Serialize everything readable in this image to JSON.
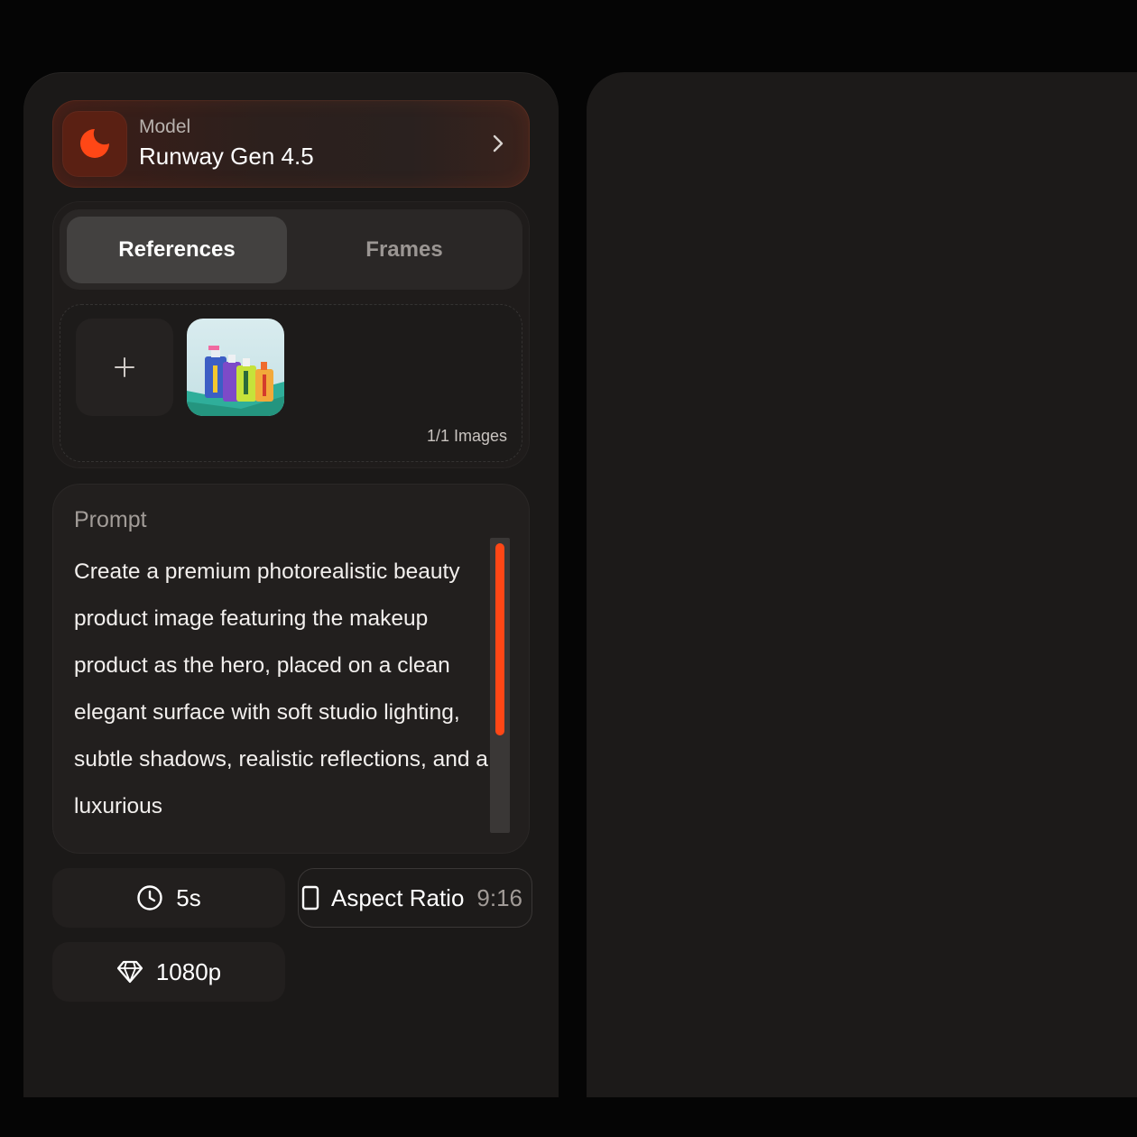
{
  "model": {
    "label": "Model",
    "name": "Runway Gen 4.5",
    "accent": "#ff4716"
  },
  "tabs": [
    {
      "label": "References",
      "active": true
    },
    {
      "label": "Frames",
      "active": false
    }
  ],
  "references": {
    "count_label": "1/1 Images",
    "add_icon": "plus-icon",
    "thumbnail_alt": "product bottles thumbnail"
  },
  "prompt": {
    "label": "Prompt",
    "text": "Create a premium photorealistic beauty product image featuring the makeup product as the hero, placed on a clean elegant surface with soft studio lighting, subtle shadows, realistic reflections, and a luxurious"
  },
  "settings": {
    "duration": "5s",
    "aspect_label": "Aspect Ratio",
    "aspect_value": "9:16",
    "quality": "1080p"
  },
  "icons": {
    "model": "runway-logo-icon",
    "chevron": "chevron-right-icon",
    "duration": "clock-icon",
    "aspect": "portrait-frame-icon",
    "quality": "diamond-icon"
  }
}
